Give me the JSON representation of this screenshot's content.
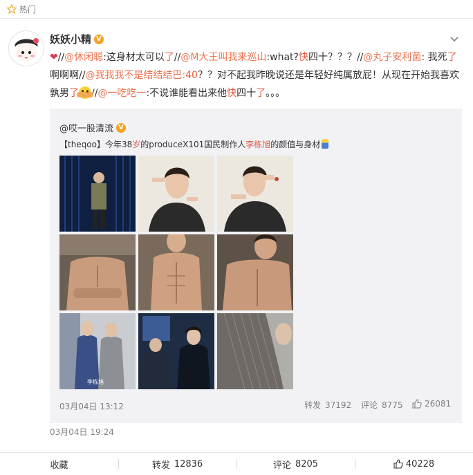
{
  "hot": {
    "label": "热门"
  },
  "post": {
    "username": "妖妖小精",
    "vbadge": "V",
    "segments": [
      {
        "text": "❤",
        "cls": "heart"
      },
      {
        "text": "//",
        "cls": "sep"
      },
      {
        "text": "@休闲聪",
        "cls": "link"
      },
      {
        "text": ":这身材太可以",
        "cls": ""
      },
      {
        "text": "了",
        "cls": "red"
      },
      {
        "text": "//",
        "cls": "sep"
      },
      {
        "text": "@M大王叫我来巡山",
        "cls": "link"
      },
      {
        "text": ":what?",
        "cls": ""
      },
      {
        "text": "快",
        "cls": "red"
      },
      {
        "text": "四十？？？",
        "cls": ""
      },
      {
        "text": "//",
        "cls": "sep"
      },
      {
        "text": "@丸子安利菌",
        "cls": "link"
      },
      {
        "text": ": 我死",
        "cls": ""
      },
      {
        "text": "了",
        "cls": "red"
      },
      {
        "text": "啊啊啊",
        "cls": ""
      },
      {
        "text": "//",
        "cls": "sep"
      },
      {
        "text": "@我我我不是结结结巴",
        "cls": "link"
      },
      {
        "text": ":40",
        "cls": "red"
      },
      {
        "text": "？？对不起我昨晚说还是年轻好纯属放屁！从现在开始我喜欢孰男",
        "cls": ""
      },
      {
        "text": "了",
        "cls": "red"
      },
      {
        "text": "",
        "cls": "emoji"
      },
      {
        "text": "//",
        "cls": "sep"
      },
      {
        "text": "@一吃吃一",
        "cls": "link"
      },
      {
        "text": ":不说谁能看出来他",
        "cls": ""
      },
      {
        "text": "快",
        "cls": "red"
      },
      {
        "text": "四十",
        "cls": ""
      },
      {
        "text": "了",
        "cls": "red"
      },
      {
        "text": "。。。",
        "cls": ""
      }
    ],
    "time": "03月04日 19:24"
  },
  "repost": {
    "user": "@哎一股清流",
    "vbadge": "V",
    "text_a": "【theqoo】今年38",
    "text_b": "岁",
    "text_c": "的produceX101国民制作人",
    "text_d": "李栋旭",
    "text_e": "的颜值与身材",
    "time": "03月04日 13:12",
    "forward_label": "转发",
    "forward_count": "37192",
    "comment_label": "评论",
    "comment_count": "8775",
    "like_count": "26081"
  },
  "photos": {
    "count": 9,
    "watermark": "李栋旭"
  },
  "bottom": {
    "collect": "收藏",
    "forward_label": "转发",
    "forward_count": "12836",
    "comment_label": "评论",
    "comment_count": "8205",
    "like_count": "40228"
  },
  "colors": {
    "link": "#eb7350",
    "accent_red": "#e35a3f",
    "muted": "#808080",
    "repost_bg": "#f2f2f5"
  }
}
